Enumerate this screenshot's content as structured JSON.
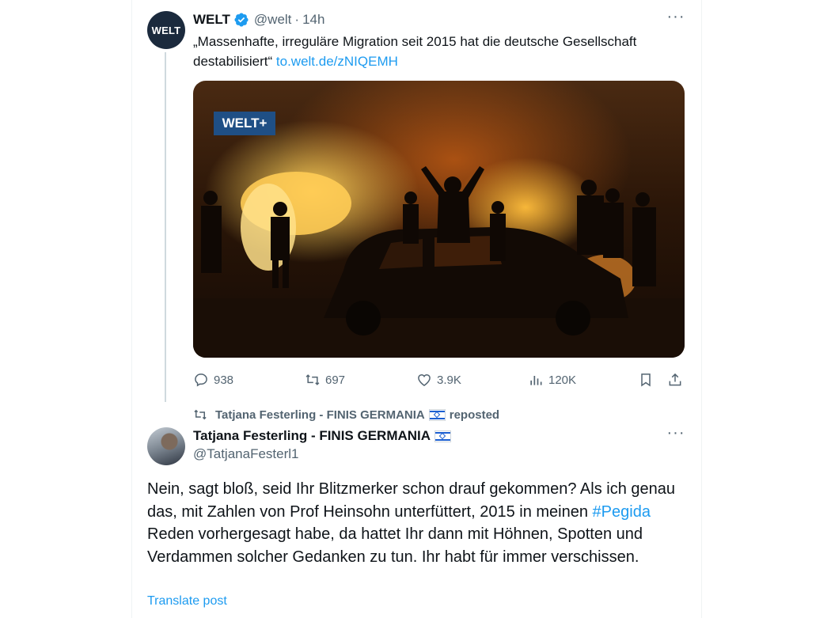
{
  "tweet": {
    "author_name": "WELT",
    "handle": "@welt",
    "separator": "·",
    "time": "14h",
    "avatar_text": "WELT",
    "more": "···",
    "text": "„Massenhafte, irreguläre Migration seit 2015 hat die deutsche Gesellschaft destabilisiert“",
    "link": "to.welt.de/zNIQEMH",
    "media_badge": "WELT+",
    "actions": {
      "replies": "938",
      "reposts": "697",
      "likes": "3.9K",
      "views": "120K"
    }
  },
  "repost_notice": {
    "user": "Tatjana Festerling - FINIS GERMANIA",
    "label": "reposted"
  },
  "reply": {
    "author_name": "Tatjana Festerling - FINIS GERMANIA",
    "handle": "@TatjanaFesterl1",
    "more": "···",
    "text_before_hashtag": "Nein, sagt bloß, seid Ihr Blitzmerker  schon drauf gekommen? Als ich genau das, mit Zahlen von Prof Heinsohn unterfüttert, 2015 in meinen ",
    "hashtag": "#Pegida",
    "text_after_hashtag": " Reden vorhergesagt habe, da hattet Ihr dann mit Höhnen, Spotten und Verdammen solcher Gedanken zu tun. Ihr habt für immer verschissen.",
    "translate_label": "Translate post"
  },
  "colors": {
    "link": "#1d9bf0",
    "muted": "#536471",
    "text": "#0f1419",
    "verified": "#1d9bf0",
    "welt_badge": "#1f4f85"
  }
}
